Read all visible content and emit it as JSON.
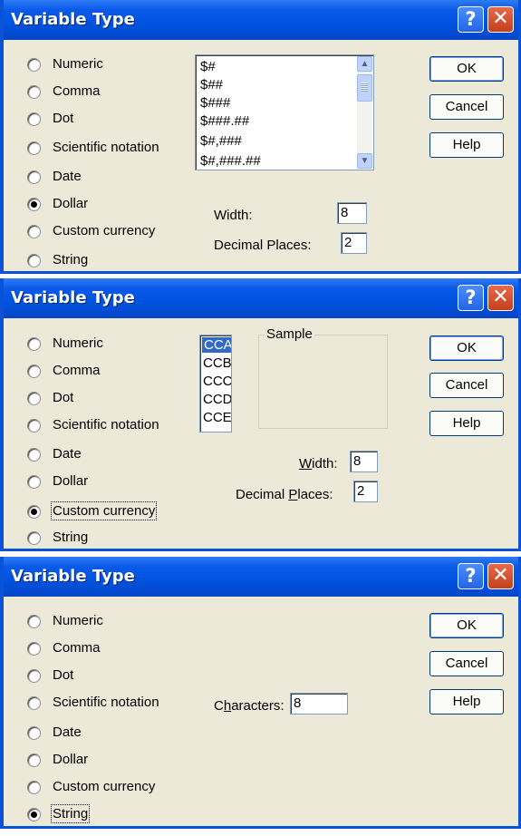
{
  "dialogs": [
    {
      "title": "Variable Type",
      "radio_options": [
        "Numeric",
        "Comma",
        "Dot",
        "Scientific notation",
        "Date",
        "Dollar",
        "Custom currency",
        "String"
      ],
      "selected": "Dollar",
      "format_list": [
        "$#",
        "$##",
        "$###",
        "$###.##",
        "$#,###",
        "$#,###.##"
      ],
      "width_label": "Width:",
      "width_value": "8",
      "decimal_label": "Decimal Places:",
      "decimal_value": "2",
      "buttons": {
        "ok": "OK",
        "cancel": "Cancel",
        "help": "Help"
      }
    },
    {
      "title": "Variable Type",
      "radio_options": [
        "Numeric",
        "Comma",
        "Dot",
        "Scientific notation",
        "Date",
        "Dollar",
        "Custom currency",
        "String"
      ],
      "selected": "Custom currency",
      "currency_list": [
        "CCA",
        "CCB",
        "CCC",
        "CCD",
        "CCE"
      ],
      "currency_selected": "CCA",
      "sample_label": "Sample",
      "width_label": "Width:",
      "width_value": "8",
      "decimal_label": "Decimal Places:",
      "decimal_value": "2",
      "buttons": {
        "ok": "OK",
        "cancel": "Cancel",
        "help": "Help"
      }
    },
    {
      "title": "Variable Type",
      "radio_options": [
        "Numeric",
        "Comma",
        "Dot",
        "Scientific notation",
        "Date",
        "Dollar",
        "Custom currency",
        "String"
      ],
      "selected": "String",
      "characters_label": "Characters:",
      "characters_value": "8",
      "buttons": {
        "ok": "OK",
        "cancel": "Cancel",
        "help": "Help"
      }
    }
  ],
  "icons": {
    "help": "question-mark-icon",
    "close": "close-x-icon",
    "scroll_up": "scroll-up-arrow-icon",
    "scroll_down": "scroll-down-arrow-icon"
  },
  "colors": {
    "titlebar": "#0052e0",
    "dialog_bg": "#ece9d8",
    "close_button": "#c4401d",
    "selection": "#316ac5"
  }
}
